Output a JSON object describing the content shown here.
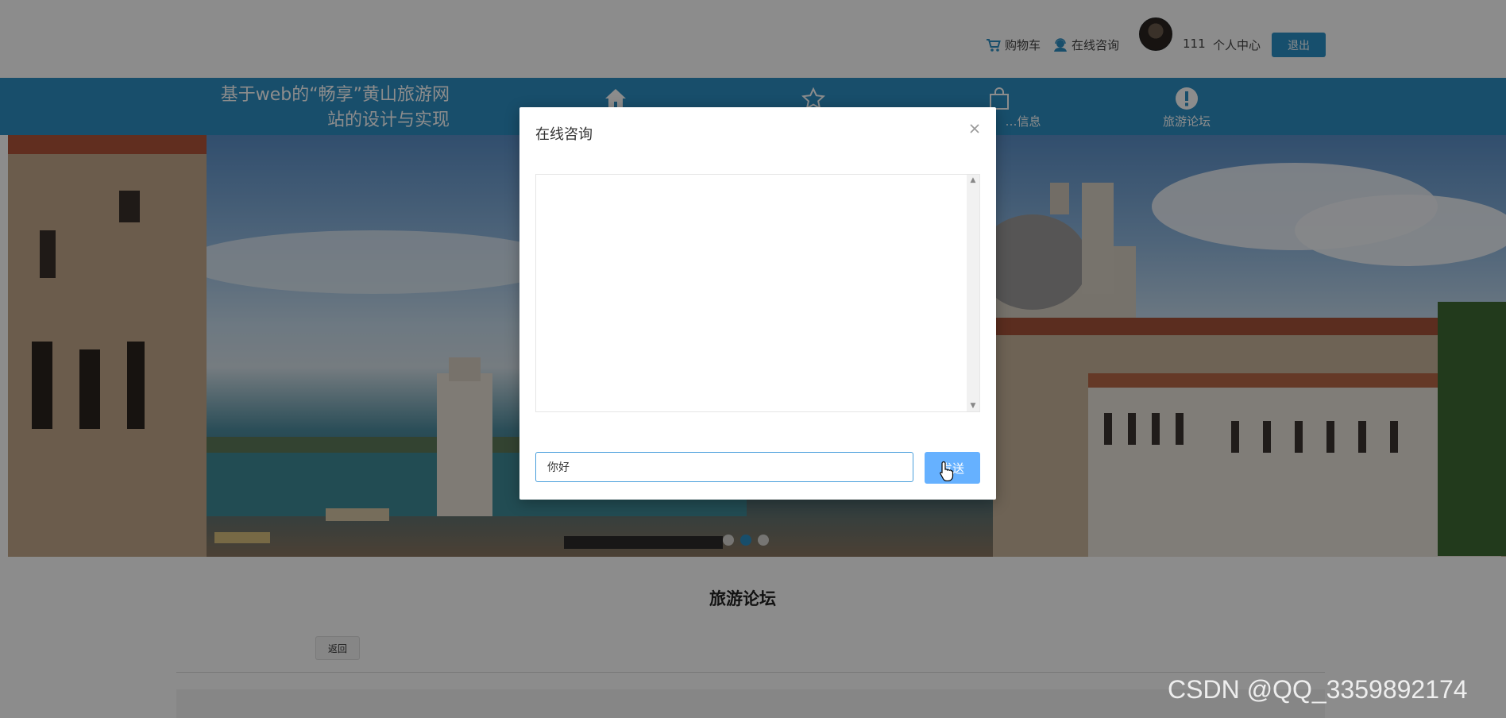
{
  "topbar": {
    "cart_label": "购物车",
    "consult_label": "在线咨询",
    "user_id": "111",
    "profile_label": "个人中心",
    "logout_label": "退出"
  },
  "nav": {
    "site_title_line1": "基于web的“畅享”黄山旅游网",
    "site_title_line2": "站的设计与实现",
    "items": [
      {
        "label": "",
        "icon": "home-icon"
      },
      {
        "label": "",
        "icon": "star-icon"
      },
      {
        "label": "…信息",
        "icon": "shopping-bag-icon"
      },
      {
        "label": "旅游论坛",
        "icon": "exclamation-icon"
      }
    ]
  },
  "banner": {
    "slide_count": 3,
    "active_slide": 2
  },
  "main": {
    "forum_title": "旅游论坛",
    "back_label": "返回"
  },
  "modal": {
    "title": "在线咨询",
    "input_value": "你好",
    "send_label": "发送"
  },
  "watermark": "CSDN @QQ_3359892174",
  "colors": {
    "nav_blue": "#2d8fc4",
    "send_button": "#66b1ff",
    "logout_button": "#2a90c7"
  }
}
